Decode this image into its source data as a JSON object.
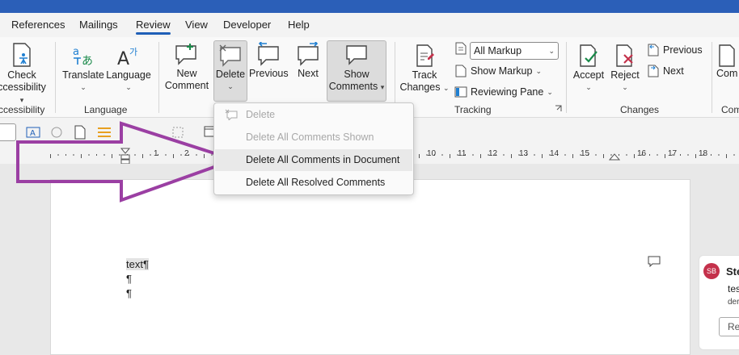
{
  "tabs": [
    {
      "label": "References"
    },
    {
      "label": "Mailings"
    },
    {
      "label": "Review"
    },
    {
      "label": "View"
    },
    {
      "label": "Developer"
    },
    {
      "label": "Help"
    }
  ],
  "ribbon": {
    "check": {
      "line1": "Check",
      "line2": "ccessibility"
    },
    "group_accessibility": "ccessibility",
    "translate": "Translate",
    "language": "Language",
    "group_language": "Language",
    "new_comment": {
      "line1": "New",
      "line2": "Comment"
    },
    "delete": "Delete",
    "previous": "Previous",
    "next": "Next",
    "show_comments": {
      "line1": "Show",
      "line2": "Comments"
    },
    "track_changes": {
      "line1": "Track",
      "line2": "Changes"
    },
    "markup_select": "All Markup",
    "show_markup": "Show Markup",
    "reviewing_pane": "Reviewing Pane",
    "group_tracking": "Tracking",
    "accept": "Accept",
    "reject": "Reject",
    "previous_change": "Previous",
    "next_change": "Next",
    "group_changes": "Changes",
    "cut_right": "Com",
    "group_cut_right": "Com"
  },
  "menu": {
    "items": [
      {
        "label": "Delete",
        "disabled": true
      },
      {
        "label": "Delete All Comments Shown",
        "disabled": true
      },
      {
        "label": "Delete All Comments in Document",
        "disabled": false
      },
      {
        "label": "Delete All Resolved Comments",
        "disabled": false
      }
    ]
  },
  "ruler": {
    "ticks": [
      "1",
      "2",
      "10",
      "11",
      "12",
      "13",
      "14",
      "15",
      "16",
      "17",
      "18"
    ]
  },
  "document": {
    "line1": "text¶",
    "line2": "¶",
    "line3": "¶"
  },
  "comment": {
    "initials": "SB",
    "name": "Ste",
    "text": "tes",
    "sub": "der",
    "reply": "Re"
  },
  "colors": {
    "accent": "#1f5fb7",
    "arrow": "#9b3fa3",
    "titlebar": "#2b5fb8"
  }
}
